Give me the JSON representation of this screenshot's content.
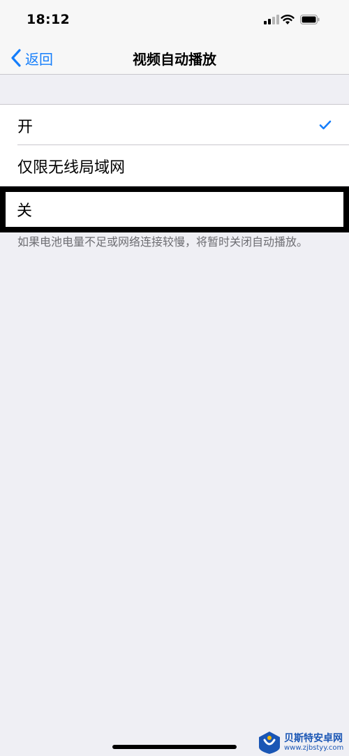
{
  "status_bar": {
    "time": "18:12",
    "icons": [
      "signal-icon",
      "wifi-icon",
      "battery-icon"
    ]
  },
  "nav": {
    "back_label": "返回",
    "title": "视频自动播放"
  },
  "options": [
    {
      "label": "开",
      "selected": true
    },
    {
      "label": "仅限无线局域网",
      "selected": false
    },
    {
      "label": "关",
      "selected": false,
      "highlighted": true
    }
  ],
  "footer_note": "如果电池电量不足或网络连接较慢，将暂时关闭自动播放。",
  "watermark": {
    "name": "贝斯特安卓网",
    "url": "www.zjbstyy.com"
  },
  "colors": {
    "accent": "#157efb",
    "background": "#efeff4",
    "separator": "#c8c7cc",
    "secondary_text": "#6d6d72",
    "highlight_border": "#000000"
  }
}
